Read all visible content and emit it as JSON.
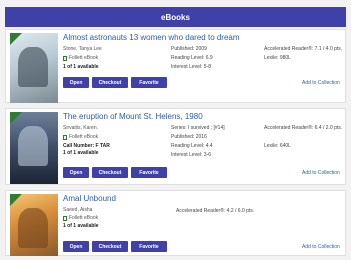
{
  "header": {
    "title": "eBooks"
  },
  "books": [
    {
      "title": "Almost astronauts 13 women who dared to dream",
      "author": "Stone, Tanya Lee",
      "format": "Follett eBook",
      "availability": "1 of 1 available",
      "published": "Published: 2009",
      "reading_level": "Reading Level: 6.9",
      "interest_level": "Interest Level: 5-8",
      "ar_label": "Accelerated Reader®: 7.1 / 4.0 pts.",
      "lexile": "Lexile: 980L",
      "buttons": [
        "Open",
        "Checkout",
        "Favorite"
      ],
      "add_label": "Add to Collection"
    },
    {
      "title": "The eruption of Mount St. Helens, 1980",
      "author": "Sirvaitis, Karen.",
      "format": "Follett eBook",
      "call_number": "Call Number: F TAR",
      "availability": "1 of 1 available",
      "series": "Series: I survived ; [#14]",
      "published": "Published: 2016",
      "reading_level": "Reading Level: 4.4",
      "interest_level": "Interest Level: 3-6",
      "ar_label": "Accelerated Reader®: 6.4 / 2.0 pts.",
      "lexile": "Lexile: 640L",
      "buttons": [
        "Open",
        "Checkout",
        "Favorite"
      ],
      "add_label": "Add to Collection"
    },
    {
      "title": "Amal Unbound",
      "author": "Saeed, Aisha",
      "format": "Follett eBook",
      "availability": "1 of 1 available",
      "ar_label": "Accelerated Reader®: 4.2 / 6.0 pts.",
      "buttons": [
        "Open",
        "Checkout",
        "Favorite"
      ],
      "add_label": "Add to Collection"
    }
  ]
}
